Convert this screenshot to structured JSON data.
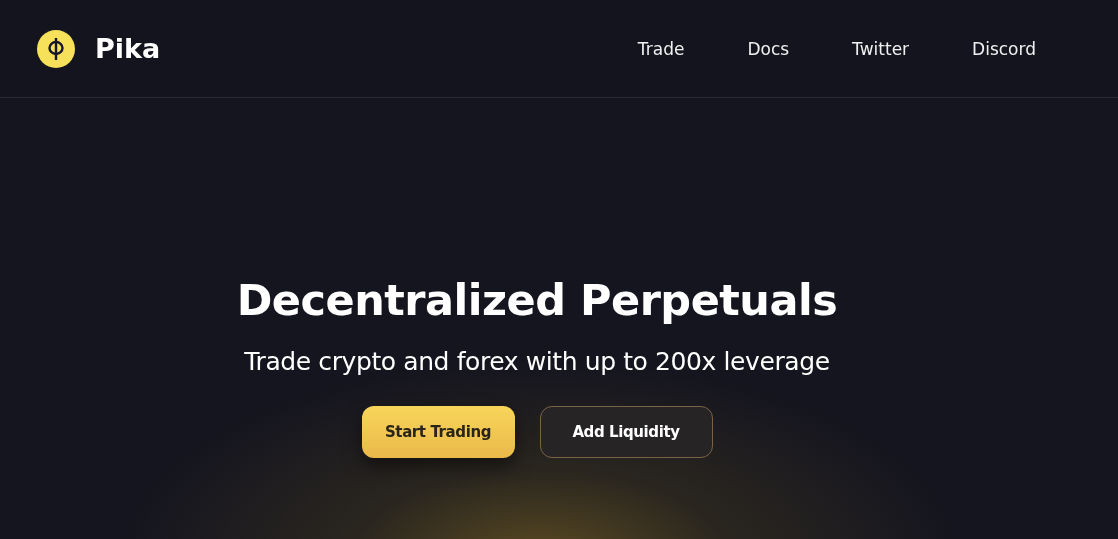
{
  "brand": {
    "name": "Pika"
  },
  "nav": [
    "Trade",
    "Docs",
    "Twitter",
    "Discord"
  ],
  "hero": {
    "title": "Decentralized Perpetuals",
    "subtitle": "Trade crypto and forex with up to 200x leverage"
  },
  "buttons": [
    {
      "label": "Start Trading",
      "kind": "primary"
    },
    {
      "label": "Add Liquidity",
      "kind": "secondary"
    }
  ]
}
